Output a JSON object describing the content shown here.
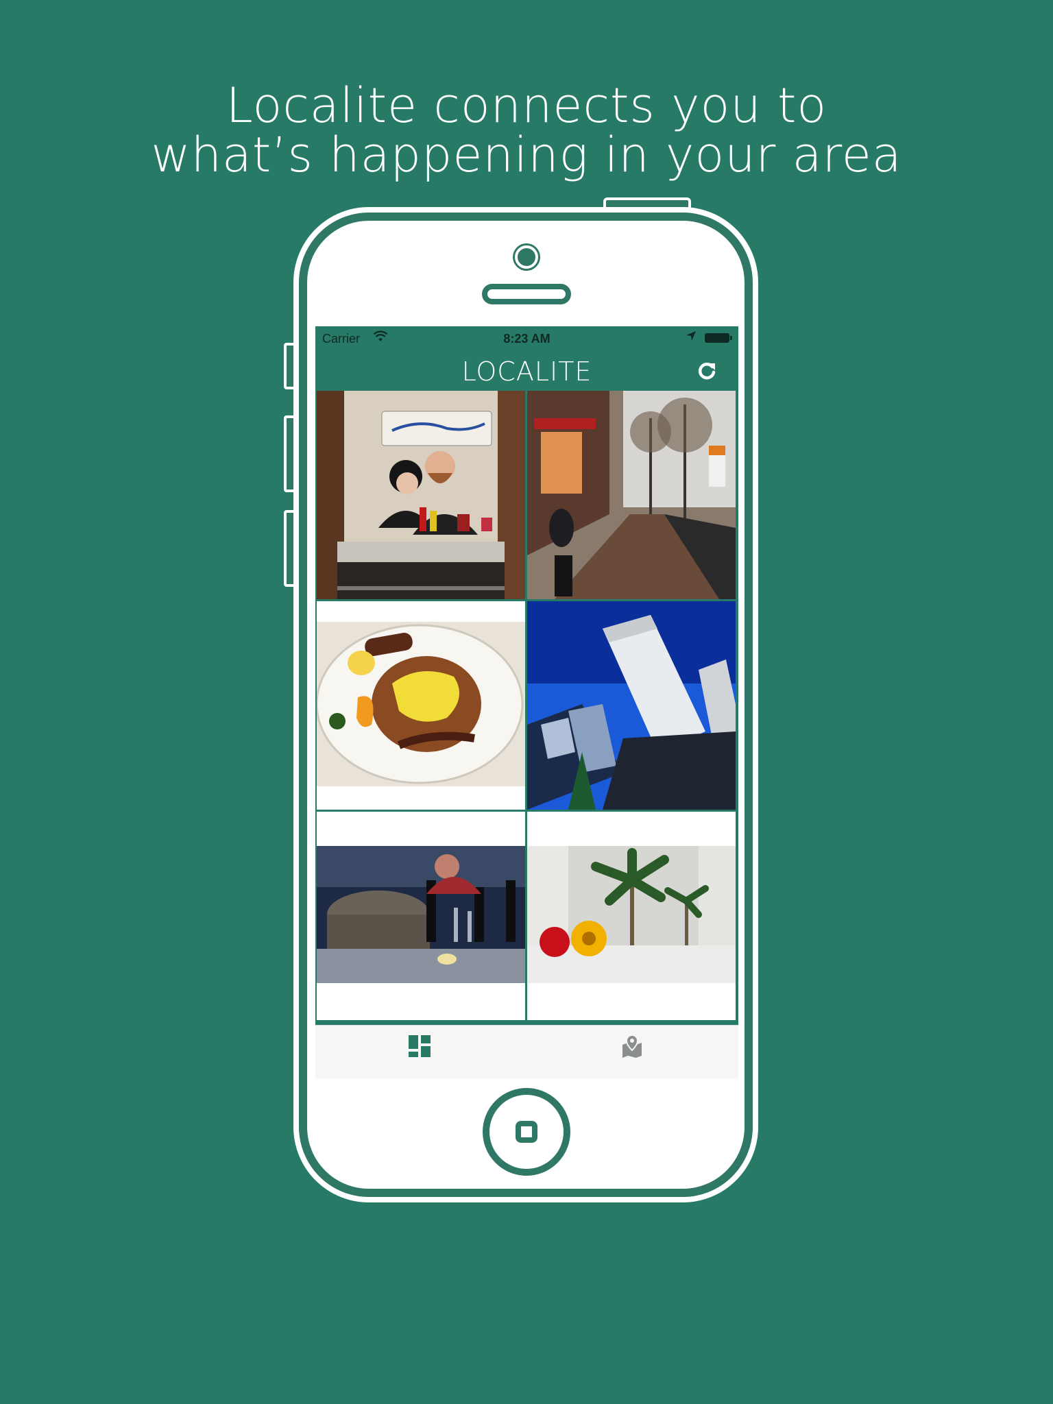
{
  "headline": {
    "line1": "Localite connects you to",
    "line2": "what’s happening in your area"
  },
  "status_bar": {
    "carrier": "Carrier",
    "time": "8:23 AM"
  },
  "nav": {
    "title": "LOCALITE"
  },
  "colors": {
    "brand_green": "#267a66",
    "phone_outline": "#2f7866",
    "tab_active": "#267a66",
    "tab_inactive": "#8a8f8d"
  },
  "icons": {
    "refresh": "refresh-icon",
    "grid_tab": "grid-tab-icon",
    "map_tab": "map-pin-icon"
  },
  "photos": [
    {
      "subject": "couple-at-diner-counter"
    },
    {
      "subject": "rainy-city-street"
    },
    {
      "subject": "pancake-breakfast-plate"
    },
    {
      "subject": "skyscraper-blue-sky"
    },
    {
      "subject": "wine-bar-counter"
    },
    {
      "subject": "atrium-palms-and-flowers"
    }
  ],
  "tabs": [
    {
      "id": "grid",
      "active": true
    },
    {
      "id": "map",
      "active": false
    }
  ]
}
